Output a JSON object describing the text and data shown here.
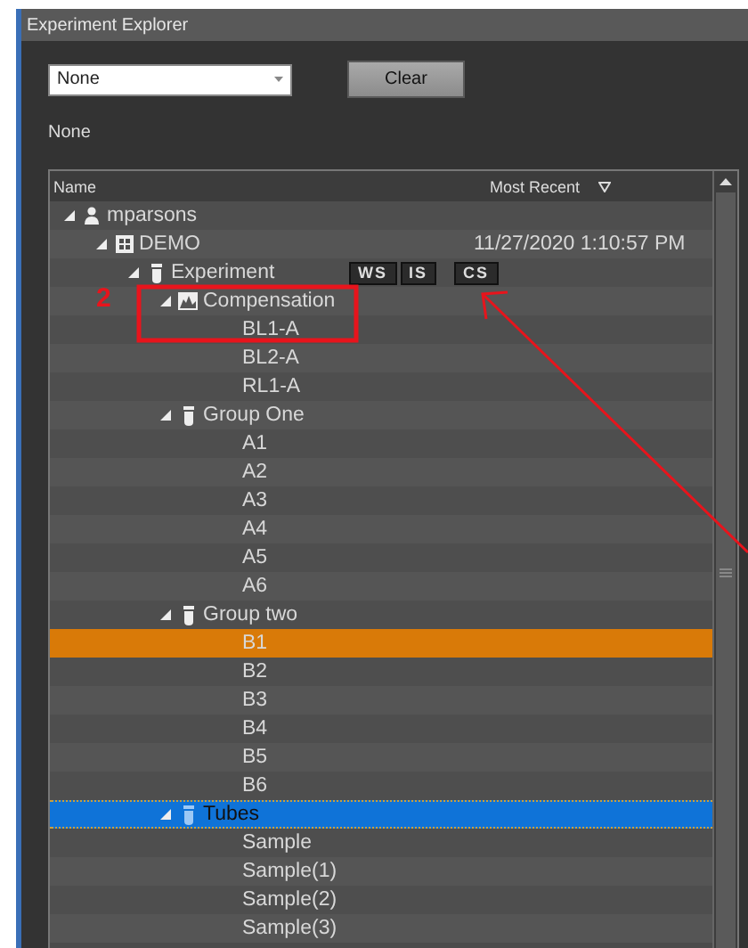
{
  "window": {
    "title": "Experiment Explorer"
  },
  "filter": {
    "value": "None"
  },
  "clear_button": "Clear",
  "filter_label": "None",
  "tree": {
    "columns": [
      "Name",
      "Most Recent"
    ],
    "items": [
      {
        "kind": "user",
        "label": "mparsons",
        "expanded": true,
        "selected": false,
        "focused": false,
        "children": [
          {
            "kind": "project",
            "label": "DEMO",
            "date": "11/27/2020 1:10:57 PM",
            "expanded": true,
            "selected": false,
            "focused": false,
            "children": [
              {
                "kind": "experiment",
                "label": "Experiment",
                "badges": [
                  "WS",
                  "IS",
                  "CS"
                ],
                "expanded": true,
                "selected": false,
                "focused": false,
                "children": [
                  {
                    "kind": "compensation",
                    "label": "Compensation",
                    "callout": "2",
                    "expanded": true,
                    "selected": false,
                    "focused": false,
                    "children": [
                      {
                        "kind": "sample",
                        "label": "BL1-A",
                        "selected": false,
                        "focused": false
                      },
                      {
                        "kind": "sample",
                        "label": "BL2-A",
                        "selected": false,
                        "focused": false
                      },
                      {
                        "kind": "sample",
                        "label": "RL1-A",
                        "selected": false,
                        "focused": false
                      }
                    ]
                  },
                  {
                    "kind": "group",
                    "label": "Group One",
                    "expanded": true,
                    "selected": false,
                    "focused": false,
                    "children": [
                      {
                        "kind": "sample",
                        "label": "A1",
                        "selected": false,
                        "focused": false
                      },
                      {
                        "kind": "sample",
                        "label": "A2",
                        "selected": false,
                        "focused": false
                      },
                      {
                        "kind": "sample",
                        "label": "A3",
                        "selected": false,
                        "focused": false
                      },
                      {
                        "kind": "sample",
                        "label": "A4",
                        "selected": false,
                        "focused": false
                      },
                      {
                        "kind": "sample",
                        "label": "A5",
                        "selected": false,
                        "focused": false
                      },
                      {
                        "kind": "sample",
                        "label": "A6",
                        "selected": false,
                        "focused": false
                      }
                    ]
                  },
                  {
                    "kind": "group",
                    "label": "Group two",
                    "expanded": true,
                    "selected": false,
                    "focused": false,
                    "children": [
                      {
                        "kind": "sample",
                        "label": "B1",
                        "selected": true,
                        "focused": false
                      },
                      {
                        "kind": "sample",
                        "label": "B2",
                        "selected": false,
                        "focused": false
                      },
                      {
                        "kind": "sample",
                        "label": "B3",
                        "selected": false,
                        "focused": false
                      },
                      {
                        "kind": "sample",
                        "label": "B4",
                        "selected": false,
                        "focused": false
                      },
                      {
                        "kind": "sample",
                        "label": "B5",
                        "selected": false,
                        "focused": false
                      },
                      {
                        "kind": "sample",
                        "label": "B6",
                        "selected": false,
                        "focused": false
                      }
                    ]
                  },
                  {
                    "kind": "group",
                    "label": "Tubes",
                    "expanded": true,
                    "selected": false,
                    "focused": true,
                    "children": [
                      {
                        "kind": "sample",
                        "label": "Sample",
                        "selected": false,
                        "focused": false
                      },
                      {
                        "kind": "sample",
                        "label": "Sample(1)",
                        "selected": false,
                        "focused": false
                      },
                      {
                        "kind": "sample",
                        "label": "Sample(2)",
                        "selected": false,
                        "focused": false
                      },
                      {
                        "kind": "sample",
                        "label": "Sample(3)",
                        "selected": false,
                        "focused": false
                      }
                    ]
                  }
                ]
              }
            ]
          }
        ]
      }
    ]
  }
}
